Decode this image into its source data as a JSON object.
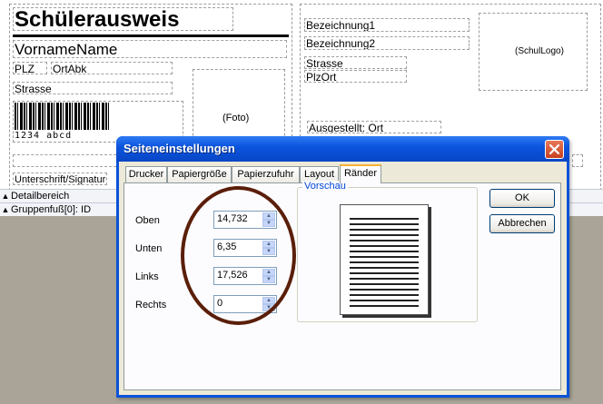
{
  "designer": {
    "title": "Schülerausweis",
    "fields": {
      "vorname_name": "VornameName",
      "plz": "PLZ",
      "ort_abk": "OrtAbk",
      "strasse_left": "Strasse",
      "barcode_text": "1234 abcd",
      "foto": "(Foto)",
      "unterschrift": "Unterschrift/Signatur",
      "bezeichnung1": "Bezeichnung1",
      "bezeichnung2": "Bezeichnung2",
      "strasse_right": "Strasse",
      "plz_ort": "PlzOrt",
      "ausgestellt": "Ausgestellt: Ort",
      "schul_logo": "(SchulLogo)"
    },
    "sections": [
      "Detailbereich",
      "Gruppenfuß[0]: ID"
    ]
  },
  "dialog": {
    "title": "Seiteneinstellungen",
    "tabs": [
      {
        "label": "Drucker",
        "active": false
      },
      {
        "label": "Papiergröße",
        "active": false
      },
      {
        "label": "Papierzufuhr",
        "active": false
      },
      {
        "label": "Layout",
        "active": false
      },
      {
        "label": "Ränder",
        "active": true
      }
    ],
    "margins": {
      "oben_label": "Oben",
      "oben_value": "14,732",
      "unten_label": "Unten",
      "unten_value": "6,35",
      "links_label": "Links",
      "links_value": "17,526",
      "rechts_label": "Rechts",
      "rechts_value": "0"
    },
    "preview_legend": "Vorschau",
    "ok_label": "OK",
    "cancel_label": "Abbrechen"
  },
  "colors": {
    "titlebar": "#0b55de",
    "annotation_ellipse": "#5a1e09",
    "dialog_bg": "#ece9d8"
  }
}
